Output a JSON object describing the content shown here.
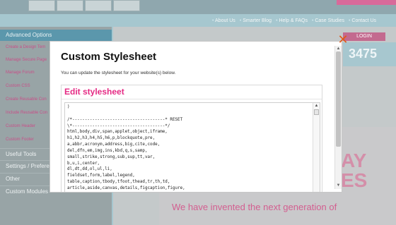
{
  "background": {
    "top_nav": [
      "About Us",
      "Smarter Blog",
      "Help & FAQs",
      "Case Studies",
      "Contact Us"
    ],
    "login_label": "LOGIN",
    "phone_fragment": "3475",
    "sidebar": {
      "advanced_options_label": "Advanced Options",
      "items": [
        "Create a Design Tem",
        "Manage Secure Page",
        "Manage Forum",
        "Custom CSS",
        "Create Reusable Con",
        "Include Reusable Con",
        "Custom Header",
        "Custom Footer"
      ],
      "groups": [
        "Useful Tools",
        "Settings / Prefere",
        "Other",
        "Custom Modules"
      ]
    },
    "hero_big_text": [
      "AY",
      "ES"
    ],
    "hero_text": "We have invented the next generation of"
  },
  "modal": {
    "title": "Custom Stylesheet",
    "description": "You can update the stylesheet for your website(s) below.",
    "close_symbol": "✕",
    "panel_title": "Edit stylesheet",
    "css_content": ")\n\n/*-------------------------------------* RESET\n\\*-------------------------------------*/\nhtml,body,div,span,applet,object,iframe,\nh1,h2,h3,h4,h5,h6,p,blockquote,pre,\na,abbr,acronym,address,big,cite,code,\ndel,dfn,em,img,ins,kbd,q,s,samp,\nsmall,strike,strong,sub,sup,tt,var,\nb,u,i,center,\ndl,dt,dd,ol,ul,li,\nfieldset,form,label,legend,\ntable,caption,tbody,tfoot,thead,tr,th,td,\narticle,aside,canvas,details,figcaption,figure,\nfooter,header,hgroup,menu,nav,section,summary,"
  }
}
